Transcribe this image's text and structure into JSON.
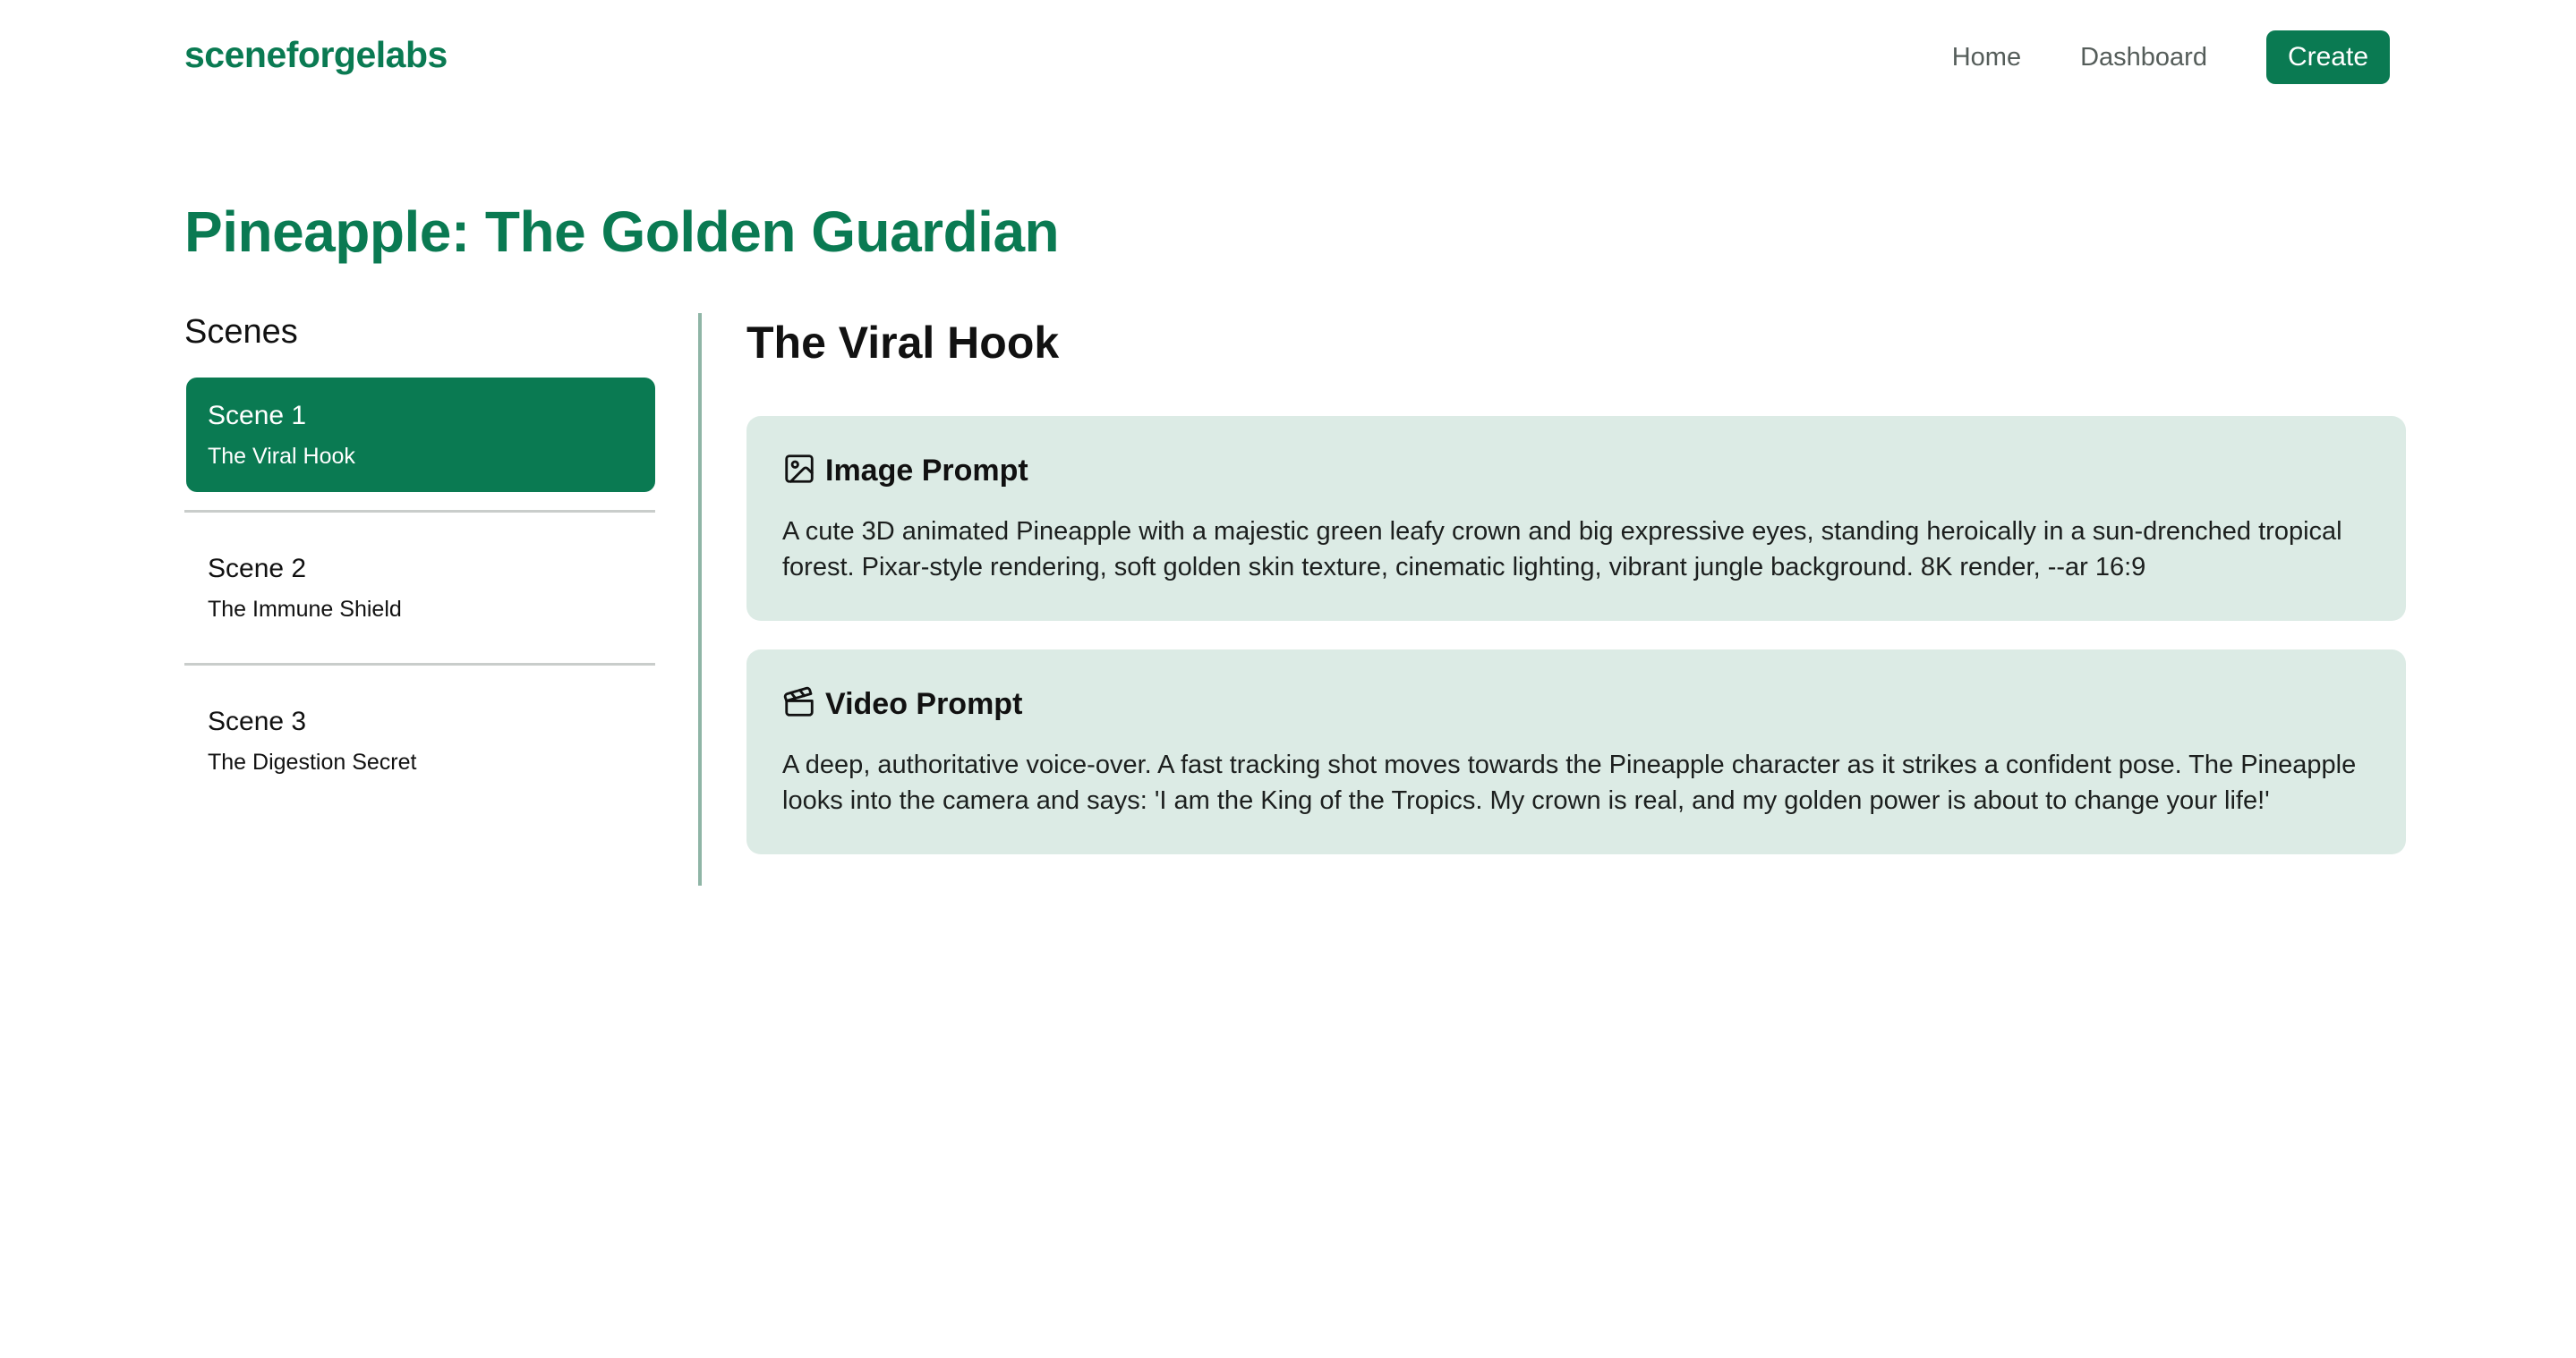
{
  "header": {
    "brand": "sceneforgelabs",
    "nav": [
      {
        "label": "Home"
      },
      {
        "label": "Dashboard"
      }
    ],
    "create_label": "Create"
  },
  "page": {
    "title": "Pineapple: The Golden Guardian"
  },
  "sidebar": {
    "title": "Scenes",
    "items": [
      {
        "label": "Scene 1",
        "subtitle": "The Viral Hook",
        "active": true
      },
      {
        "label": "Scene 2",
        "subtitle": "The Immune Shield",
        "active": false
      },
      {
        "label": "Scene 3",
        "subtitle": "The Digestion Secret",
        "active": false
      }
    ]
  },
  "main": {
    "title": "The Viral Hook",
    "image_prompt": {
      "icon": "image-icon",
      "heading": "Image Prompt",
      "text": "A cute 3D animated Pineapple with a majestic green leafy crown and big expressive eyes, standing heroically in a sun-drenched tropical forest. Pixar-style rendering, soft golden skin texture, cinematic lighting, vibrant jungle background. 8K render, --ar 16:9"
    },
    "video_prompt": {
      "icon": "clapperboard-icon",
      "heading": "Video Prompt",
      "text": "A deep, authoritative voice-over. A fast tracking shot moves towards the Pineapple character as it strikes a confident pose. The Pineapple looks into the camera and says: 'I am the King of the Tropics. My crown is real, and my golden power is about to change your life!'"
    }
  },
  "colors": {
    "accent": "#0a7a52",
    "card_bg": "#dcebe5",
    "divider": "#8fb5a6"
  }
}
